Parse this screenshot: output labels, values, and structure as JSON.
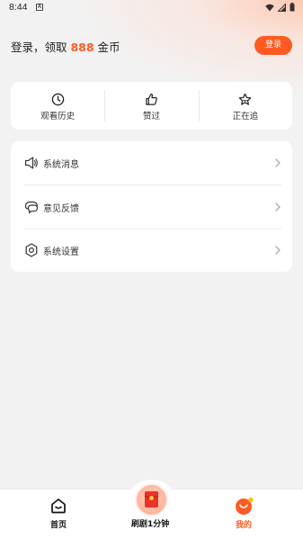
{
  "status_bar": {
    "time": "8:44",
    "notification_badge": "A"
  },
  "login": {
    "prefix": "登录，领取 ",
    "coins": "888",
    "suffix": " 金币",
    "button_label": "登录"
  },
  "quick_actions": [
    {
      "label": "观看历史",
      "icon": "clock-icon"
    },
    {
      "label": "赞过",
      "icon": "thumbs-up-icon"
    },
    {
      "label": "正在追",
      "icon": "star-icon"
    }
  ],
  "menu": [
    {
      "label": "系统消息",
      "icon": "speaker-icon"
    },
    {
      "label": "意见反馈",
      "icon": "chat-bubble-icon"
    },
    {
      "label": "系统设置",
      "icon": "gear-icon"
    }
  ],
  "tabs": [
    {
      "label": "首页",
      "icon": "home-icon"
    },
    {
      "label": "刷剧1分钟",
      "icon": "red-envelope-icon"
    },
    {
      "label": "我的",
      "icon": "smile-face-icon",
      "active": true
    }
  ],
  "colors": {
    "accent": "#ff5a21",
    "background": "#f2f2f3",
    "card": "#ffffff"
  }
}
